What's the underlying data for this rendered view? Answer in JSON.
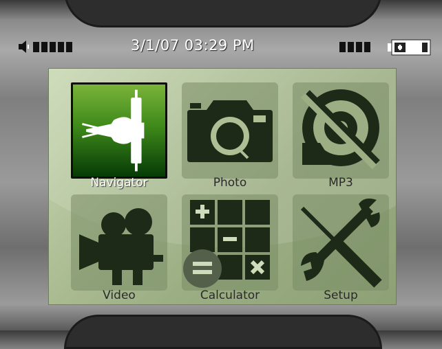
{
  "status": {
    "datetime": "3/1/07 03:29 PM",
    "volume_level_bars": 5,
    "signal_level_bars": 4,
    "icons": [
      "speaker-icon",
      "battery-icon"
    ]
  },
  "menu": {
    "selected": "Navigator",
    "items": [
      {
        "label": "Navigator",
        "icon": "satellite-dish-icon"
      },
      {
        "label": "Photo",
        "icon": "camera-icon"
      },
      {
        "label": "MP3",
        "icon": "disc-muted-icon"
      },
      {
        "label": "Video",
        "icon": "film-camera-icon"
      },
      {
        "label": "Calculator",
        "icon": "calculator-icon"
      },
      {
        "label": "Setup",
        "icon": "wrench-screwdriver-icon"
      }
    ]
  },
  "colors": {
    "screen_bg": "#aebf96",
    "selected_tile": "#2f7d13",
    "icon_dark": "#1e2a18"
  }
}
